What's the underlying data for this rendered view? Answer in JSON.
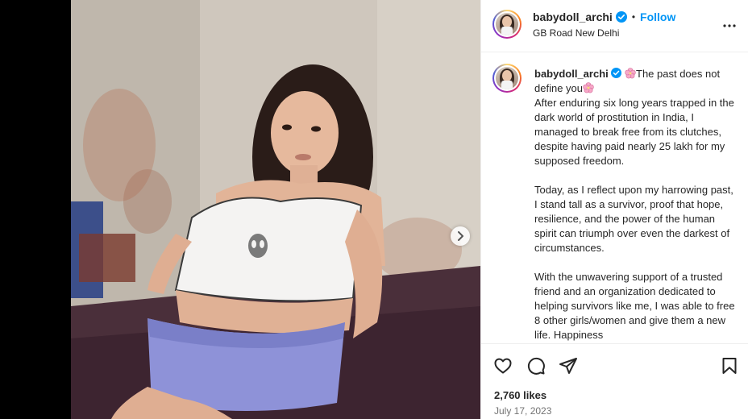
{
  "post": {
    "username": "babydoll_archi",
    "follow_label": "Follow",
    "separator": "•",
    "location": "GB Road New Delhi",
    "caption_title": "The past does not define you",
    "caption_p1": "After enduring six long years trapped in the dark world of prostitution in India, I managed to break free from its clutches, despite having paid nearly 25 lakh for my supposed freedom.",
    "caption_p2": "Today, as I reflect upon my harrowing past, I stand tall as a survivor, proof that hope, resilience, and the power of the human spirit can triumph over even the darkest of circumstances.",
    "caption_p3": "With the unwavering support of a trusted friend and an organization dedicated to helping survivors like me, I was able to free 8 other girls/women and give them a new life. Happiness",
    "likes": "2,760 likes",
    "date": "July 17, 2023"
  },
  "icons": {
    "verified": "verified-badge-icon",
    "more": "more-options-icon",
    "next": "chevron-right-icon",
    "like": "heart-icon",
    "comment": "comment-icon",
    "share": "share-icon",
    "save": "bookmark-icon"
  },
  "colors": {
    "accent": "#0095f6",
    "text": "#262626",
    "muted": "#737373",
    "flower": "#f7a8c8"
  }
}
